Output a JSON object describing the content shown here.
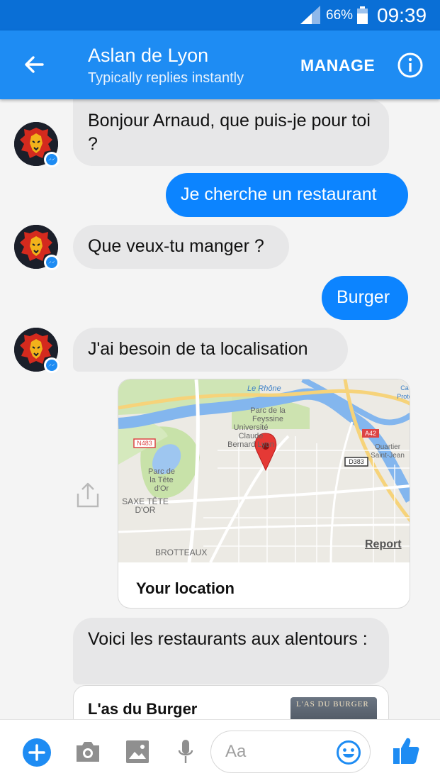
{
  "status_bar": {
    "battery": "66%",
    "time": "09:39"
  },
  "header": {
    "title": "Aslan de Lyon",
    "subtitle": "Typically replies instantly",
    "manage": "MANAGE"
  },
  "messages": [
    {
      "from": "bot",
      "text": "Bonjour Arnaud, que puis-je pour toi ?"
    },
    {
      "from": "user",
      "text": "Je cherche un restaurant"
    },
    {
      "from": "bot",
      "text": "Que veux-tu manger ?"
    },
    {
      "from": "user",
      "text": "Burger"
    },
    {
      "from": "bot",
      "text": "J'ai besoin de ta localisation"
    },
    {
      "from": "bot",
      "text": "Voici les restaurants aux alentours :"
    }
  ],
  "location_card": {
    "label": "Your location",
    "report": "Report",
    "map_labels": {
      "river": "Le Rhône",
      "park1": "Parc de la Feyssine",
      "univ": "Université Claude Bernard Lyon",
      "park2": "Parc de la Tête d'Or",
      "saxe": "SAXE TÊTE D'OR",
      "brotteaux": "BROTTEAUX",
      "quartier": "Quartier Saint-Jean",
      "road1": "N483",
      "road2": "A42",
      "road3": "D383",
      "corner": "Ca Prote"
    }
  },
  "restaurant_card": {
    "name": "L'as du Burger",
    "thumb_text": "L'AS DU BURGER"
  },
  "composer": {
    "placeholder": "Aa"
  },
  "colors": {
    "messenger_blue": "#0c84ff",
    "header_blue": "#1e8cf3"
  }
}
